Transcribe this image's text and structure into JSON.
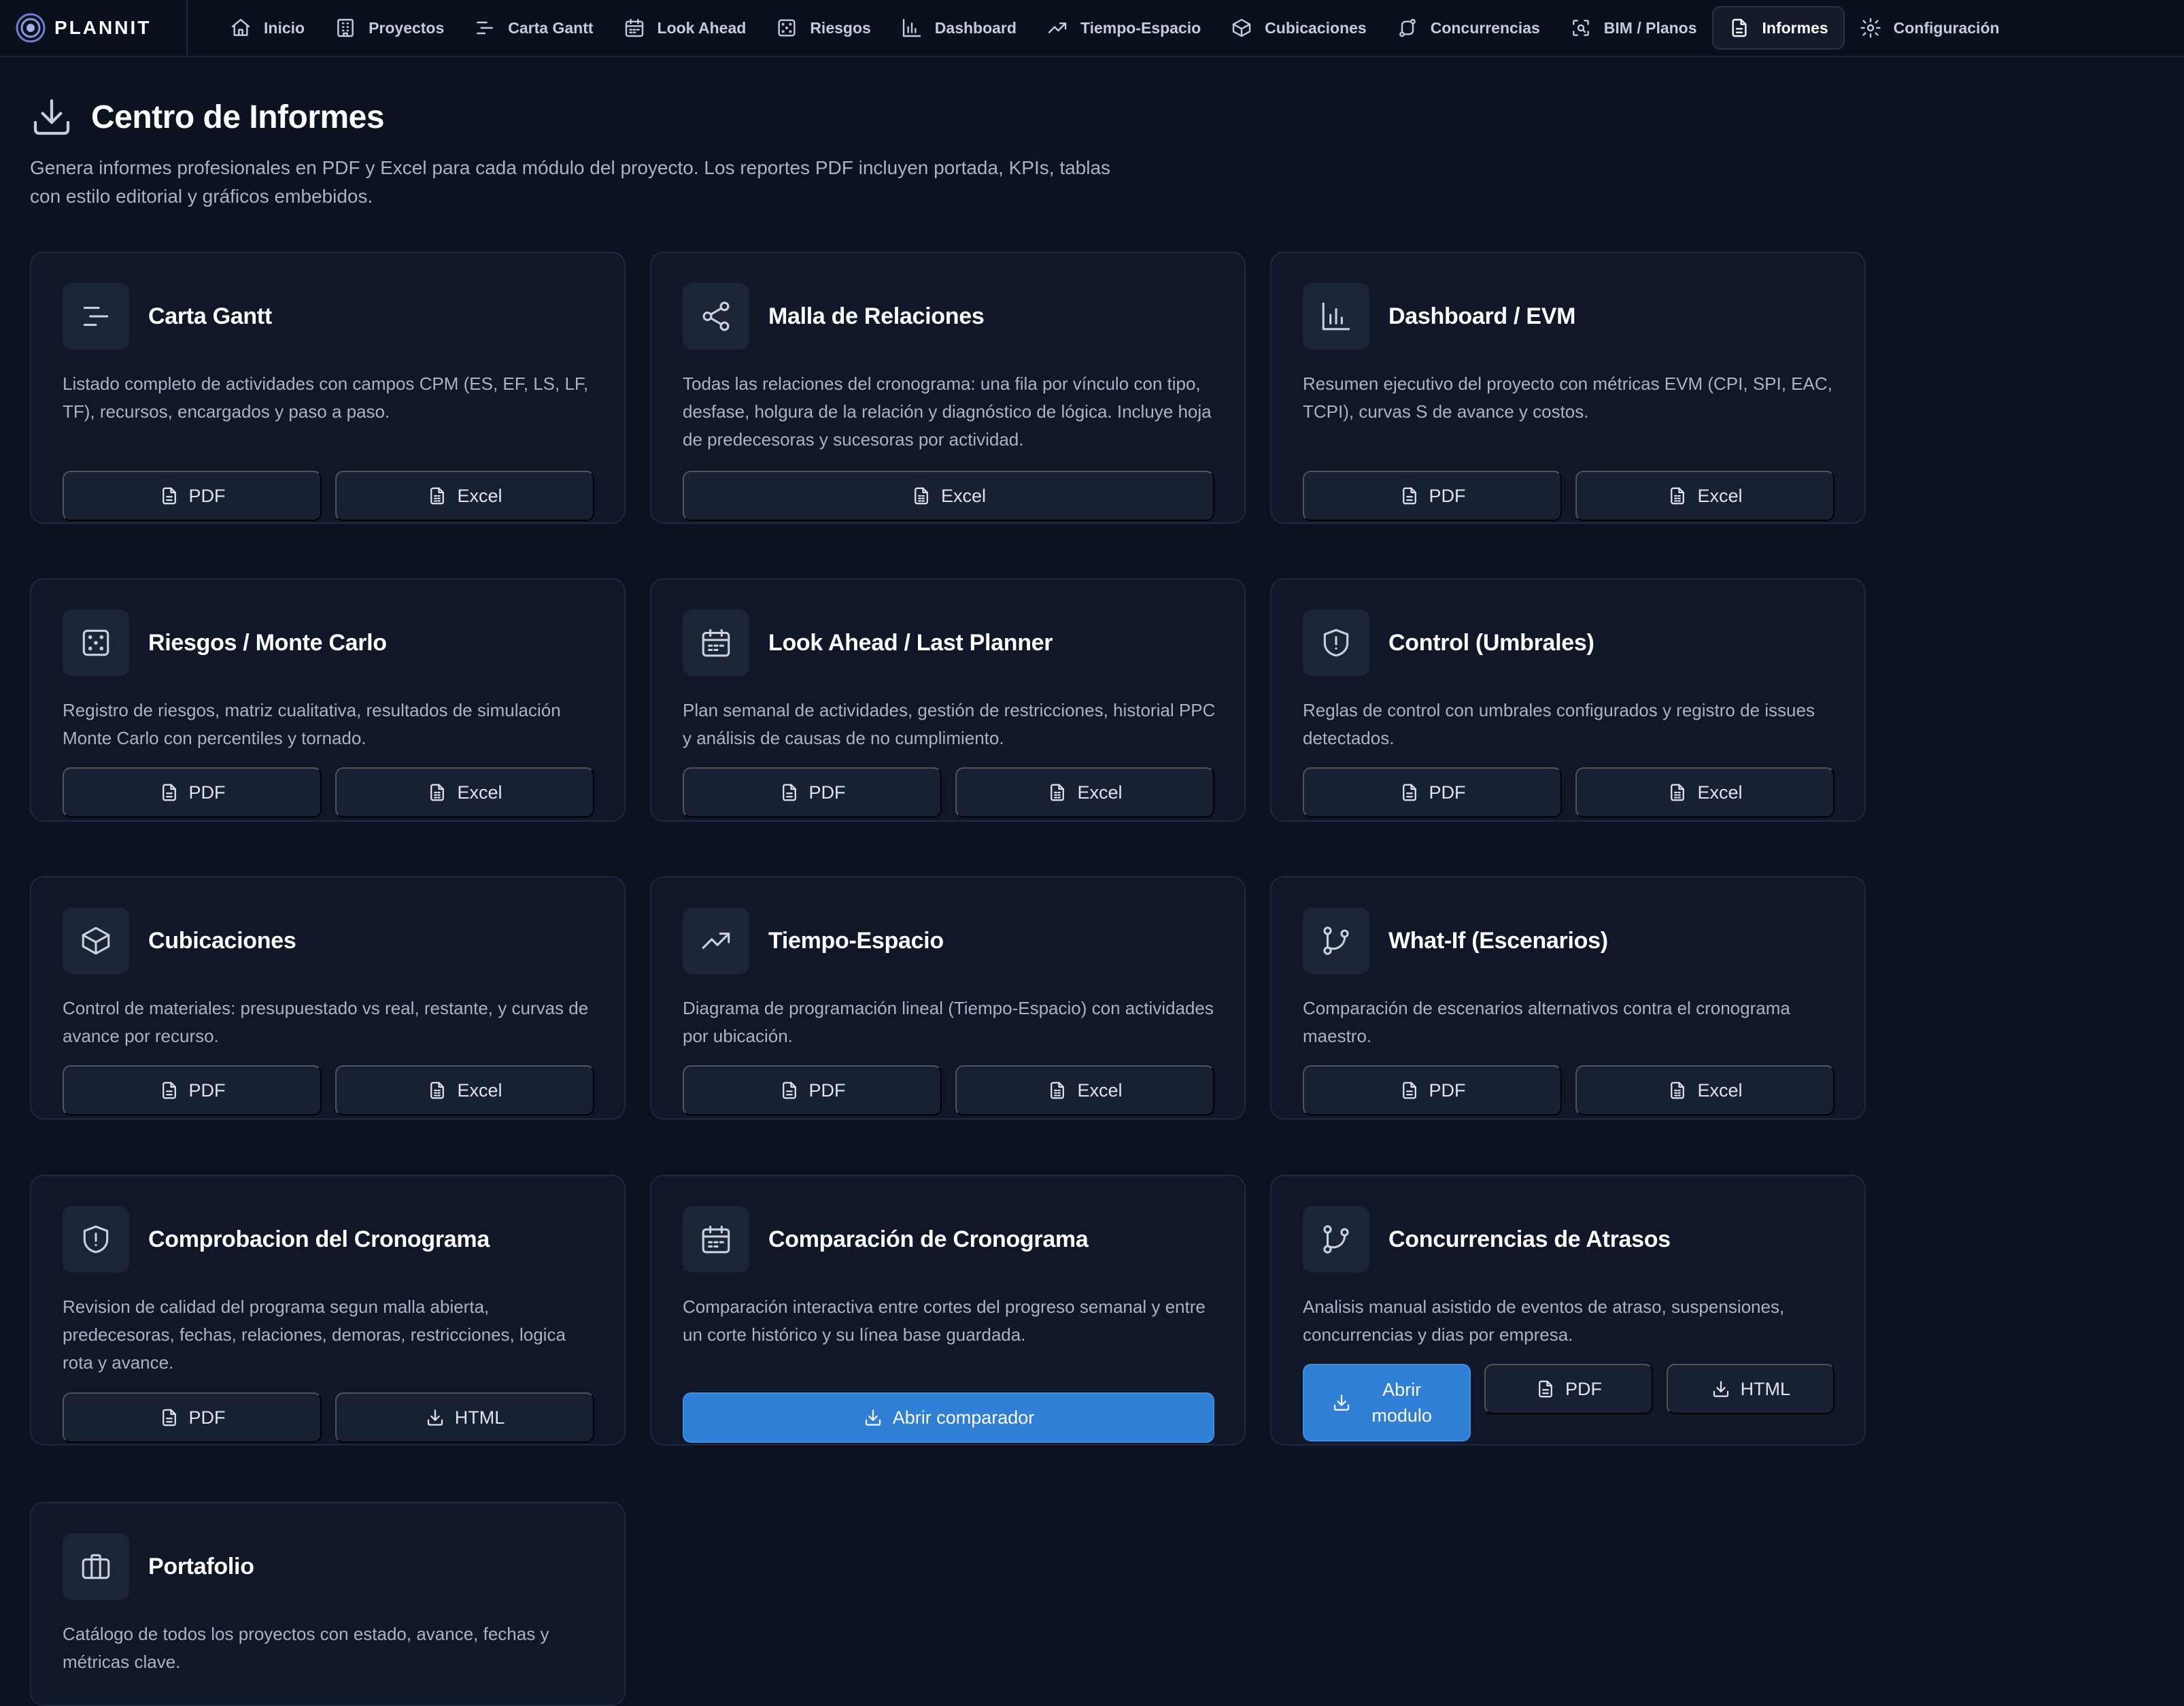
{
  "brand": {
    "name": "PLANNIT"
  },
  "nav": [
    {
      "label": "Inicio",
      "icon": "home-icon"
    },
    {
      "label": "Proyectos",
      "icon": "building-icon"
    },
    {
      "label": "Carta Gantt",
      "icon": "gantt-icon"
    },
    {
      "label": "Look Ahead",
      "icon": "calendar-icon"
    },
    {
      "label": "Riesgos",
      "icon": "dice-icon"
    },
    {
      "label": "Dashboard",
      "icon": "bar-chart-icon"
    },
    {
      "label": "Tiempo-Espacio",
      "icon": "trend-icon"
    },
    {
      "label": "Cubicaciones",
      "icon": "box-icon"
    },
    {
      "label": "Concurrencias",
      "icon": "route-icon"
    },
    {
      "label": "BIM / Planos",
      "icon": "scan-icon"
    },
    {
      "label": "Informes",
      "icon": "document-icon",
      "active": true
    },
    {
      "label": "Configuración",
      "icon": "gear-icon"
    }
  ],
  "header": {
    "title": "Centro de Informes",
    "description": "Genera informes profesionales en PDF y Excel para cada módulo del proyecto. Los reportes PDF incluyen portada, KPIs, tablas con estilo editorial y gráficos embebidos."
  },
  "cards": [
    {
      "title": "Carta Gantt",
      "icon": "gantt-icon",
      "description": "Listado completo de actividades con campos CPM (ES, EF, LS, LF, TF), recursos, encargados y paso a paso.",
      "buttons": [
        {
          "label": "PDF",
          "icon": "document-icon"
        },
        {
          "label": "Excel",
          "icon": "spreadsheet-icon"
        }
      ]
    },
    {
      "title": "Malla de Relaciones",
      "icon": "share-icon",
      "description": "Todas las relaciones del cronograma: una fila por vínculo con tipo, desfase, holgura de la relación y diagnóstico de lógica. Incluye hoja de predecesoras y sucesoras por actividad.",
      "buttons": [
        {
          "label": "Excel",
          "icon": "spreadsheet-icon"
        }
      ]
    },
    {
      "title": "Dashboard / EVM",
      "icon": "bar-chart-icon",
      "description": "Resumen ejecutivo del proyecto con métricas EVM (CPI, SPI, EAC, TCPI), curvas S de avance y costos.",
      "buttons": [
        {
          "label": "PDF",
          "icon": "document-icon"
        },
        {
          "label": "Excel",
          "icon": "spreadsheet-icon"
        }
      ]
    },
    {
      "title": "Riesgos / Monte Carlo",
      "icon": "dice-icon",
      "description": "Registro de riesgos, matriz cualitativa, resultados de simulación Monte Carlo con percentiles y tornado.",
      "buttons": [
        {
          "label": "PDF",
          "icon": "document-icon"
        },
        {
          "label": "Excel",
          "icon": "spreadsheet-icon"
        }
      ]
    },
    {
      "title": "Look Ahead / Last Planner",
      "icon": "calendar-icon",
      "description": "Plan semanal de actividades, gestión de restricciones, historial PPC y análisis de causas de no cumplimiento.",
      "buttons": [
        {
          "label": "PDF",
          "icon": "document-icon"
        },
        {
          "label": "Excel",
          "icon": "spreadsheet-icon"
        }
      ]
    },
    {
      "title": "Control (Umbrales)",
      "icon": "shield-alert-icon",
      "description": "Reglas de control con umbrales configurados y registro de issues detectados.",
      "buttons": [
        {
          "label": "PDF",
          "icon": "document-icon"
        },
        {
          "label": "Excel",
          "icon": "spreadsheet-icon"
        }
      ]
    },
    {
      "title": "Cubicaciones",
      "icon": "box-icon",
      "description": "Control de materiales: presupuestado vs real, restante, y curvas de avance por recurso.",
      "buttons": [
        {
          "label": "PDF",
          "icon": "document-icon"
        },
        {
          "label": "Excel",
          "icon": "spreadsheet-icon"
        }
      ]
    },
    {
      "title": "Tiempo-Espacio",
      "icon": "trend-icon",
      "description": "Diagrama de programación lineal (Tiempo-Espacio) con actividades por ubicación.",
      "buttons": [
        {
          "label": "PDF",
          "icon": "document-icon"
        },
        {
          "label": "Excel",
          "icon": "spreadsheet-icon"
        }
      ]
    },
    {
      "title": "What-If (Escenarios)",
      "icon": "git-branch-icon",
      "description": "Comparación de escenarios alternativos contra el cronograma maestro.",
      "buttons": [
        {
          "label": "PDF",
          "icon": "document-icon"
        },
        {
          "label": "Excel",
          "icon": "spreadsheet-icon"
        }
      ]
    },
    {
      "title": "Comprobacion del Cronograma",
      "icon": "shield-alert-icon",
      "description": "Revision de calidad del programa segun malla abierta, predecesoras, fechas, relaciones, demoras, restricciones, logica rota y avance.",
      "buttons": [
        {
          "label": "PDF",
          "icon": "document-icon"
        },
        {
          "label": "HTML",
          "icon": "download-icon"
        }
      ]
    },
    {
      "title": "Comparación de Cronograma",
      "icon": "calendar-icon",
      "description": "Comparación interactiva entre cortes del progreso semanal y entre un corte histórico y su línea base guardada.",
      "buttons": [
        {
          "label": "Abrir comparador",
          "icon": "download-icon",
          "primary": true
        }
      ]
    },
    {
      "title": "Concurrencias de Atrasos",
      "icon": "git-branch-icon",
      "description": "Analisis manual asistido de eventos de atraso, suspensiones, concurrencias y dias por empresa.",
      "buttons": [
        {
          "label": "Abrir modulo",
          "icon": "download-icon",
          "primary": true,
          "two_line": true
        },
        {
          "label": "PDF",
          "icon": "document-icon"
        },
        {
          "label": "HTML",
          "icon": "download-icon"
        }
      ]
    },
    {
      "title": "Portafolio",
      "icon": "briefcase-icon",
      "description": "Catálogo de todos los proyectos con estado, avance, fechas y métricas clave.",
      "buttons": []
    }
  ]
}
